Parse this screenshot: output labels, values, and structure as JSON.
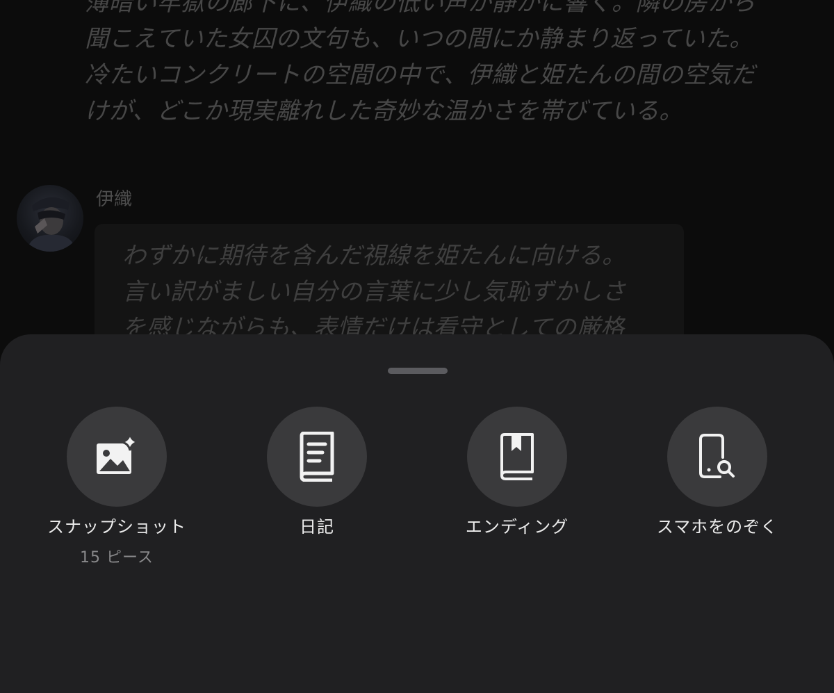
{
  "chat": {
    "narration": "薄暗い牢獄の廊下に、伊織の低い声が静かに響く。隣の房から\n聞こえていた女囚の文句も、いつの間にか静まり返っていた。\n冷たいコンクリートの空間の中で、伊織と姫たんの間の空気だ\nけが、どこか現実離れした奇妙な温かさを帯びている。",
    "message": {
      "sender": "伊織",
      "text": "わずかに期待を含んだ視線を姫たんに向ける。\n言い訳がましい自分の言葉に少し気恥ずかしさ\nを感じながらも、表情だけは看守としての厳格"
    }
  },
  "sheet": {
    "actions": [
      {
        "label": "スナップショット",
        "sublabel": "15 ピース",
        "icon": "image-sparkle-icon"
      },
      {
        "label": "日記",
        "icon": "book-icon"
      },
      {
        "label": "エンディング",
        "icon": "bookmark-book-icon"
      },
      {
        "label": "スマホをのぞく",
        "icon": "phone-search-icon"
      }
    ]
  },
  "colors": {
    "sheet_background": "#202022",
    "action_circle": "#3a3a3c",
    "label": "#ececec",
    "sublabel": "#8a8a8c"
  }
}
